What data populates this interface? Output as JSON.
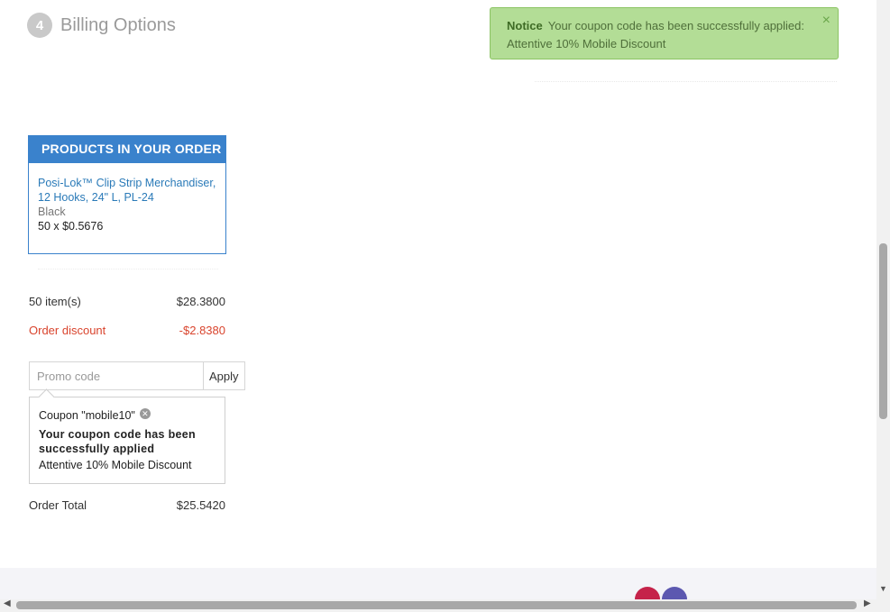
{
  "step": {
    "number": "4",
    "title": "Billing Options"
  },
  "notice": {
    "label": "Notice",
    "message": "Your coupon code has been successfully applied:",
    "detail": "Attentive 10% Mobile Discount",
    "close_glyph": "×"
  },
  "products": {
    "heading": "PRODUCTS IN YOUR ORDER",
    "items": [
      {
        "name": "Posi-Lok™ Clip Strip Merchandiser, 12 Hooks, 24\" L, PL-24",
        "variant": "Black",
        "quantity_price": "50 x $0.5676"
      }
    ]
  },
  "summary": {
    "items_label": "50 item(s)",
    "items_value": "$28.3800",
    "discount_label": "Order discount",
    "discount_value": "-$2.8380",
    "total_label": "Order Total",
    "total_value": "$25.5420"
  },
  "promo": {
    "placeholder": "Promo code",
    "value": "",
    "apply_label": "Apply"
  },
  "coupon": {
    "label": "Coupon \"mobile10\"",
    "success": "Your coupon code has been successfully applied",
    "description": "Attentive 10% Mobile Discount"
  },
  "colors": {
    "accent": "#3a82cc",
    "notice_bg": "#b3dd96",
    "discount": "#d9442d"
  },
  "icons": {
    "notice_close": "close-icon",
    "coupon_remove": "remove-circle-icon"
  }
}
